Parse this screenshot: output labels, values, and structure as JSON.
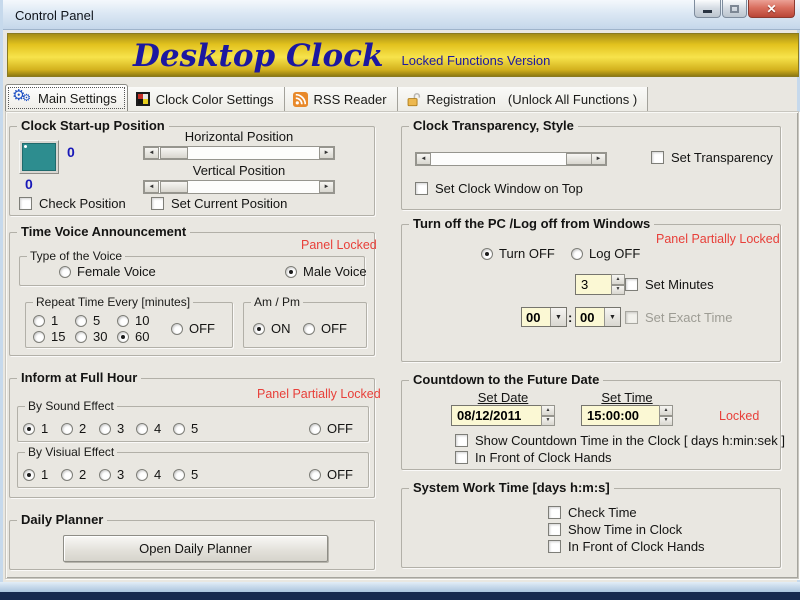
{
  "window": {
    "title": "Control Panel"
  },
  "banner": {
    "title": "Desktop Clock",
    "subtitle": "Locked Functions Version"
  },
  "tabs": [
    {
      "label": "Main Settings",
      "icon": "gears-icon",
      "active": true
    },
    {
      "label": "Clock Color Settings",
      "icon": "color-grid-icon",
      "active": false
    },
    {
      "label": "RSS Reader",
      "icon": "rss-icon",
      "active": false
    },
    {
      "label": "Registration",
      "suffix": "(Unlock All Functions )",
      "icon": "padlock-icon",
      "active": false
    }
  ],
  "startup": {
    "title": "Clock Start-up Position",
    "x_value": "0",
    "y_value": "0",
    "horizontal_label": "Horizontal Position",
    "vertical_label": "Vertical Position",
    "check_position": "Check Position",
    "set_current_position": "Set Current Position",
    "swatch_color": "#2d8d8f"
  },
  "time_voice": {
    "title": "Time Voice Announcement",
    "status": "Panel Locked",
    "voice_type": {
      "title": "Type of the Voice",
      "female": "Female Voice",
      "male": "Male Voice",
      "selected": "Male Voice"
    },
    "repeat": {
      "title": "Repeat Time Every  [minutes]",
      "options": [
        "1",
        "5",
        "10",
        "15",
        "30",
        "60"
      ],
      "off_label": "OFF",
      "selected": "60"
    },
    "ampm": {
      "title": "Am / Pm",
      "on_label": "ON",
      "off_label": "OFF",
      "selected": "ON"
    }
  },
  "inform": {
    "title": "Inform at Full Hour",
    "status": "Panel Partially Locked",
    "sound": {
      "title": "By Sound Effect",
      "options": [
        "1",
        "2",
        "3",
        "4",
        "5"
      ],
      "off_label": "OFF",
      "selected": "1"
    },
    "visual": {
      "title": "By Visiual Effect",
      "options": [
        "1",
        "2",
        "3",
        "4",
        "5"
      ],
      "off_label": "OFF",
      "selected": "1"
    }
  },
  "planner": {
    "title": "Daily Planner",
    "button_label": "Open Daily Planner"
  },
  "transparency": {
    "title": "Clock Transparency, Style",
    "set_transparency": "Set Transparency",
    "set_on_top": "Set Clock Window on Top"
  },
  "power": {
    "title": "Turn off the PC /Log off from Windows",
    "status": "Panel Partially Locked",
    "turn_off": "Turn OFF",
    "log_off": "Log OFF",
    "selected": "Turn OFF",
    "minutes_value": "3",
    "set_minutes": "Set Minutes",
    "hours_value": "00",
    "time_separator": ":",
    "mins_value": "00",
    "set_exact_time": "Set Exact Time",
    "set_exact_time_enabled": false
  },
  "countdown": {
    "title": "Countdown to the Future Date",
    "set_date_label": "Set Date",
    "set_time_label": "Set Time",
    "date_value": "08/12/2011",
    "time_value": "15:00:00",
    "status": "Locked",
    "show_countdown": "Show Countdown Time in the Clock  [ days  h:min:sek ]",
    "in_front": "In Front of Clock Hands"
  },
  "system_work": {
    "title": "System Work Time [days h:m:s]",
    "check_time": "Check Time",
    "show_in_clock": "Show Time in Clock",
    "in_front": "In Front of Clock Hands"
  },
  "colors": {
    "locked_red": "#e8403a",
    "value_blue": "#1818b8",
    "banner_text": "#1c18a0",
    "banner_gold": "#e2c21e",
    "input_cream": "#fbf8d4",
    "swatch_teal": "#2d8d8f"
  }
}
